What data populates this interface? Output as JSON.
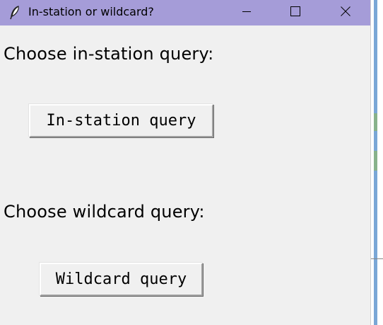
{
  "window": {
    "title": "In-station or wildcard?",
    "app_icon": "feather-icon",
    "controls": {
      "minimize_icon": "minimize-icon",
      "maximize_icon": "maximize-icon",
      "close_icon": "close-icon"
    },
    "titlebar_color": "#a59cd8",
    "background_color": "#f0f0f0"
  },
  "in_station": {
    "heading": "Choose in-station query:",
    "button_label": "In-station query"
  },
  "wildcard": {
    "heading": "Choose wildcard query:",
    "button_label": "Wildcard query"
  }
}
